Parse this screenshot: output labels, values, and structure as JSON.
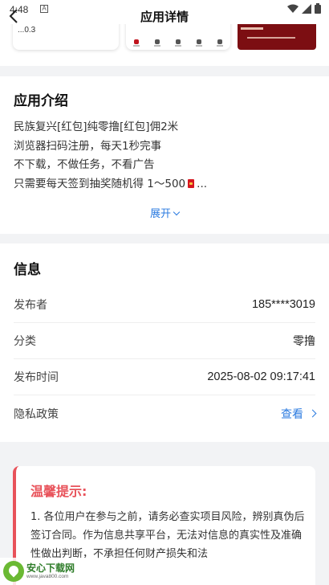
{
  "status_bar": {
    "time": "4:48",
    "notification_glyph": "A",
    "icons": [
      "wifi-icon",
      "signal-icon",
      "battery-icon"
    ]
  },
  "nav": {
    "title": "应用详情",
    "back_icon": "chevron-left-icon"
  },
  "screenshot_strip": {
    "shot1_text": "...0.3"
  },
  "intro": {
    "title": "应用介绍",
    "lines": [
      "民族复兴[红包]纯零撸[红包]佣2米",
      "浏览器扫码注册，每天1秒完事",
      "不下载，不做任务，不看广告"
    ],
    "last_line_prefix": "只需要每天签到抽奖随机得 1～500",
    "last_line_suffix": "...",
    "expand_label": "展开"
  },
  "info": {
    "title": "信息",
    "rows": [
      {
        "label": "发布者",
        "value": "185****3019"
      },
      {
        "label": "分类",
        "value": "零撸"
      },
      {
        "label": "发布时间",
        "value": "2025-08-02 09:17:41"
      },
      {
        "label": "隐私政策",
        "value": "查看"
      }
    ]
  },
  "warning": {
    "title": "温馨提示:",
    "text": "1. 各位用户在参与之前，请务必查实项目风险，辨别真伪后签订合同。作为信息共享平台，无法对信息的真实性及准确性做出判断，不承担任何财产损失和法"
  },
  "watermark": {
    "name": "安心下载网",
    "url": "www.java800.com"
  },
  "colors": {
    "accent": "#2b7be0",
    "warning": "#e8525a",
    "envelope": "#d6161f",
    "page_bg": "#f2f3f5"
  }
}
